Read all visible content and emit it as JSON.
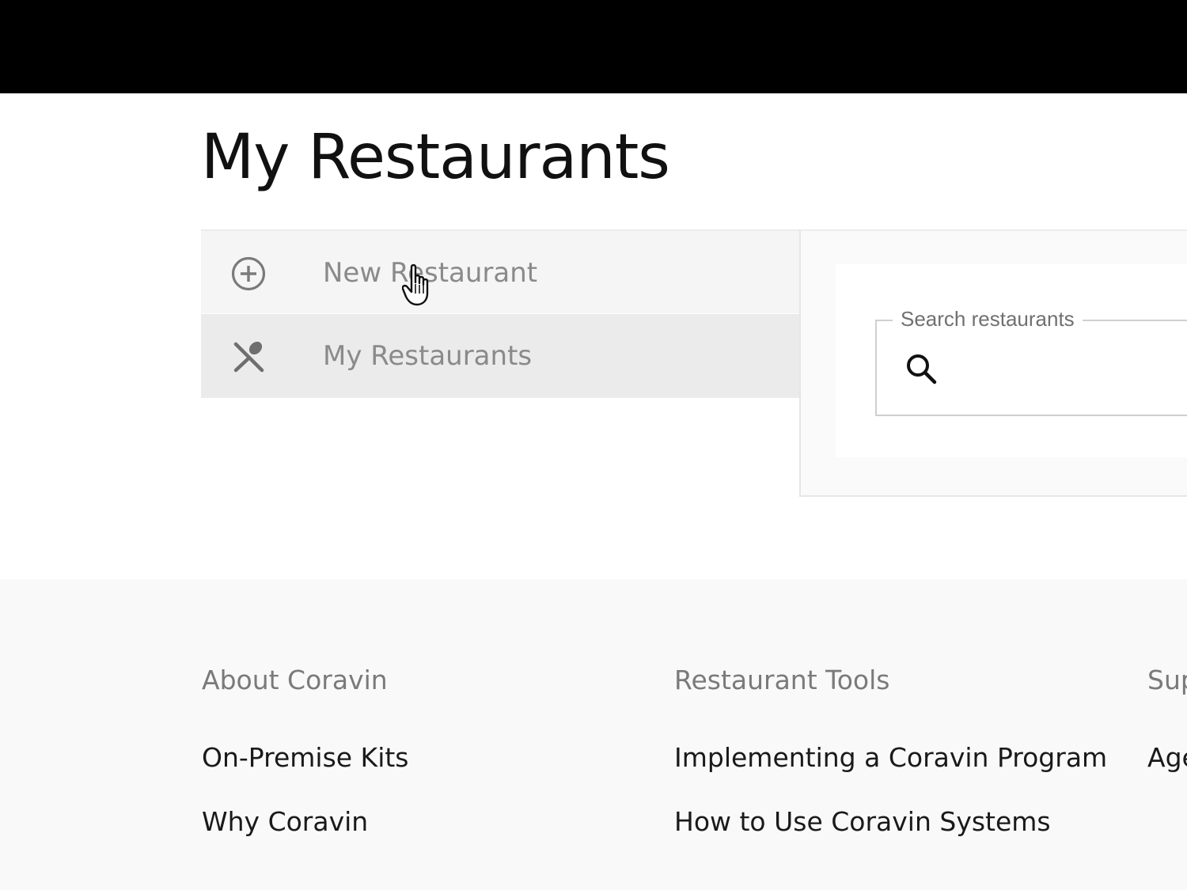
{
  "header": {
    "title": "My Restaurants"
  },
  "sidebar": {
    "items": [
      {
        "label": "New Restaurant",
        "icon": "plus-circle-icon"
      },
      {
        "label": "My Restaurants",
        "icon": "fork-spoon-icon",
        "active": true
      }
    ]
  },
  "search": {
    "label": "Search restaurants",
    "value": "",
    "icon": "search-icon"
  },
  "footer": {
    "columns": [
      {
        "heading": "About Coravin",
        "links": [
          "On-Premise Kits",
          "Why Coravin"
        ]
      },
      {
        "heading": "Restaurant Tools",
        "links": [
          "Implementing a Coravin Program",
          "How to Use Coravin Systems"
        ]
      },
      {
        "heading": "Sup",
        "links": [
          "Age"
        ]
      }
    ]
  },
  "colors": {
    "topbar": "#000000",
    "active_item": "#ebebeb",
    "nav_text": "#8a8a8a"
  }
}
